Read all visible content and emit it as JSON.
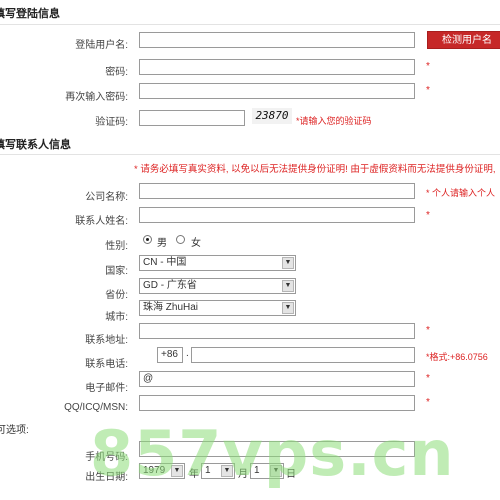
{
  "login": {
    "title": "填写登陆信息",
    "username_label": "登陆用户名:",
    "username_value": "",
    "check_button": "检测用户名",
    "password_label": "密码:",
    "repeat_label": "再次输入密码:",
    "captcha_label": "验证码:",
    "captcha_code": "23870",
    "captcha_hint": "*请输入您的验证码"
  },
  "contact": {
    "title": "填写联系人信息",
    "notice": "* 请务必填写真实资料, 以免以后无法提供身份证明! 由于虚假资料而无法提供身份证明,",
    "company_label": "公司名称:",
    "company_hint": "* 个人请输入个人",
    "name_label": "联系人姓名:",
    "gender_label": "性别:",
    "male": "男",
    "female": "女",
    "country_label": "国家:",
    "country_value": "CN - 中国",
    "province_label": "省份:",
    "province_value": "GD - 广东省",
    "city_label": "城市:",
    "city_value": "珠海 ZhuHai",
    "address_label": "联系地址:",
    "phone_label": "联系电话:",
    "phone_code": "+86",
    "phone_sep": ".",
    "phone_hint": "*格式:+86.0756",
    "email_label": "电子邮件:",
    "email_value": "@",
    "qq_label": "QQ/ICQ/MSN:"
  },
  "optional": {
    "title": "可选项:",
    "mobile_label": "手机号码:",
    "birthday_label": "出生日期:",
    "year_value": "1979",
    "year_unit": "年",
    "month_value": "1",
    "month_unit": "月",
    "day_value": "1",
    "day_unit": "日"
  },
  "asterisk": "*",
  "watermark": "857vps.cn",
  "colors": {
    "accent_red": "#c62828",
    "required": "#dd2222"
  }
}
